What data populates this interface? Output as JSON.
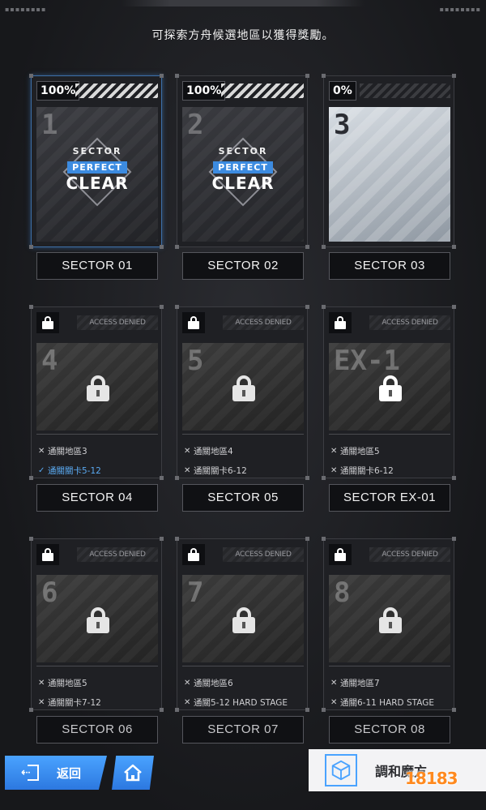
{
  "header": {
    "hint": "可探索方舟候選地區以獲得獎勵。"
  },
  "sectors": [
    {
      "number": "1",
      "percent": "100%",
      "badge": {
        "line1": "SECTOR",
        "line2": "PERFECT",
        "line3": "CLEAR"
      },
      "label": "SECTOR 01",
      "status": "cleared"
    },
    {
      "number": "2",
      "percent": "100%",
      "badge": {
        "line1": "SECTOR",
        "line2": "PERFECT",
        "line3": "CLEAR"
      },
      "label": "SECTOR 02",
      "status": "cleared"
    },
    {
      "number": "3",
      "percent": "0%",
      "label": "SECTOR 03",
      "status": "open"
    },
    {
      "number": "4",
      "denied": "ACCESS DENIED",
      "label": "SECTOR 04",
      "status": "locked",
      "requirements": [
        {
          "text": "通關地區3",
          "met": false
        },
        {
          "text": "通關關卡5-12",
          "met": true
        }
      ]
    },
    {
      "number": "5",
      "denied": "ACCESS DENIED",
      "label": "SECTOR 05",
      "status": "locked",
      "requirements": [
        {
          "text": "通關地區4",
          "met": false
        },
        {
          "text": "通關關卡6-12",
          "met": false
        }
      ]
    },
    {
      "number": "EX-1",
      "denied": "ACCESS DENIED",
      "label": "SECTOR EX-01",
      "status": "locked",
      "requirements": [
        {
          "text": "通關地區5",
          "met": false
        },
        {
          "text": "通關關卡6-12",
          "met": false
        }
      ]
    },
    {
      "number": "6",
      "denied": "ACCESS DENIED",
      "label": "SECTOR 06",
      "status": "locked",
      "requirements": [
        {
          "text": "通關地區5",
          "met": false
        },
        {
          "text": "通關關卡7-12",
          "met": false
        }
      ]
    },
    {
      "number": "7",
      "denied": "ACCESS DENIED",
      "label": "SECTOR 07",
      "status": "locked",
      "requirements": [
        {
          "text": "通關地區6",
          "met": false
        },
        {
          "text": "通關5-12 HARD STAGE",
          "met": false
        }
      ]
    },
    {
      "number": "8",
      "denied": "ACCESS DENIED",
      "label": "SECTOR 08",
      "status": "locked",
      "requirements": [
        {
          "text": "通關地區7",
          "met": false
        },
        {
          "text": "通關6-11 HARD STAGE",
          "met": false
        }
      ]
    }
  ],
  "marks": {
    "met": "✓",
    "unmet": "✕"
  },
  "footer": {
    "back_label": "返回",
    "harmony_label": "調和魔方",
    "watermark": "18183"
  },
  "icons": {
    "back": "exit-door-icon",
    "home": "home-icon",
    "harmony": "cube-icon",
    "lock": "lock-icon"
  },
  "colors": {
    "accent": "#3c8be0",
    "met": "#5aa9f0",
    "background": "#1b1c1f"
  }
}
